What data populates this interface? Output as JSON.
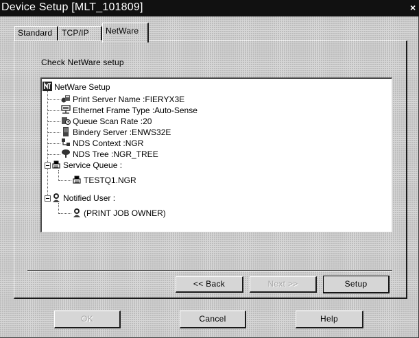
{
  "window": {
    "title": "Device Setup [MLT_101809]",
    "close_glyph": "×"
  },
  "tabs": [
    {
      "label": "Standard",
      "active": false
    },
    {
      "label": "TCP/IP",
      "active": false
    },
    {
      "label": "NetWare",
      "active": true
    }
  ],
  "panel": {
    "heading": "Check NetWare setup"
  },
  "tree": {
    "root": {
      "label": "NetWare Setup",
      "icon": "netware-icon"
    },
    "items": [
      {
        "label": "Print Server Name :FIERYX3E",
        "icon": "print-server-icon"
      },
      {
        "label": "Ethernet Frame Type :Auto-Sense",
        "icon": "network-frame-icon"
      },
      {
        "label": "Queue Scan Rate :20",
        "icon": "queue-scan-icon"
      },
      {
        "label": "Bindery Server :ENWS32E",
        "icon": "server-tower-icon"
      },
      {
        "label": "NDS Context :NGR",
        "icon": "nds-context-icon"
      },
      {
        "label": "NDS Tree :NGR_TREE",
        "icon": "nds-tree-icon"
      },
      {
        "label": "Service Queue :",
        "icon": "print-queue-icon",
        "expanded": true,
        "children": [
          {
            "label": "TESTQ1.NGR",
            "icon": "print-queue-icon"
          }
        ]
      },
      {
        "label": "Notified User :",
        "icon": "user-icon",
        "expanded": true,
        "children": [
          {
            "label": "(PRINT JOB OWNER)",
            "icon": "user-icon"
          }
        ]
      }
    ]
  },
  "wizard_buttons": {
    "back": "<< Back",
    "next": "Next >>",
    "setup": "Setup"
  },
  "dialog_buttons": {
    "ok": "OK",
    "cancel": "Cancel",
    "help": "Help"
  }
}
